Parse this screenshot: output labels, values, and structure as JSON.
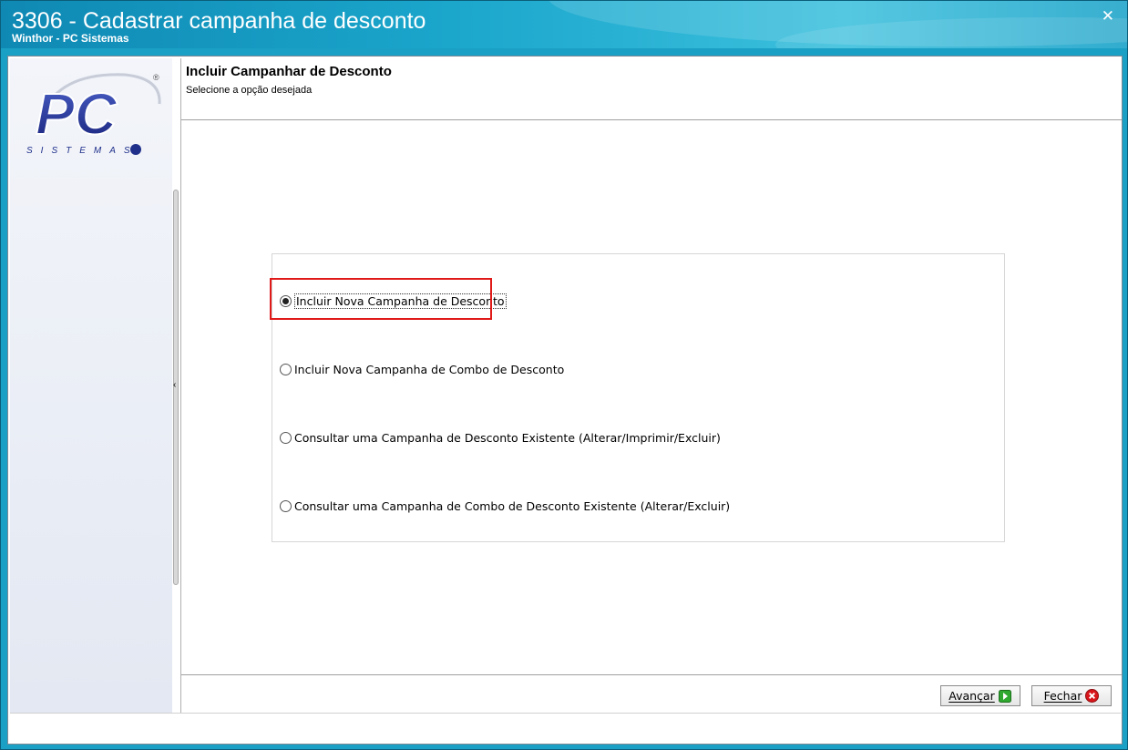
{
  "window": {
    "title": "3306 - Cadastrar campanha de desconto",
    "subtitle": "Winthor - PC Sistemas",
    "close_symbol": "✕"
  },
  "sidebar": {
    "logo": {
      "text": "PC",
      "sub_text": "SISTEMAS",
      "mark": "®"
    }
  },
  "header": {
    "title": "Incluir Campanhar de Desconto",
    "subtitle": "Selecione a opção desejada"
  },
  "options": [
    {
      "label": "Incluir Nova Campanha de Desconto",
      "selected": true
    },
    {
      "label": "Incluir Nova Campanha de Combo de Desconto",
      "selected": false
    },
    {
      "label": "Consultar uma Campanha de Desconto Existente (Alterar/Imprimir/Excluir)",
      "selected": false
    },
    {
      "label": "Consultar uma Campanha de Combo de Desconto Existente (Alterar/Excluir)",
      "selected": false
    }
  ],
  "buttons": {
    "next": {
      "label": "Avançar",
      "icon": "arrow-right-green-icon"
    },
    "close": {
      "label": "Fechar",
      "icon": "close-red-icon"
    }
  },
  "colors": {
    "title_bar": "#1ba6cc",
    "highlight": "#e01919",
    "logo_blue": "#1f2f8a",
    "logo_red": "#d8161b"
  }
}
